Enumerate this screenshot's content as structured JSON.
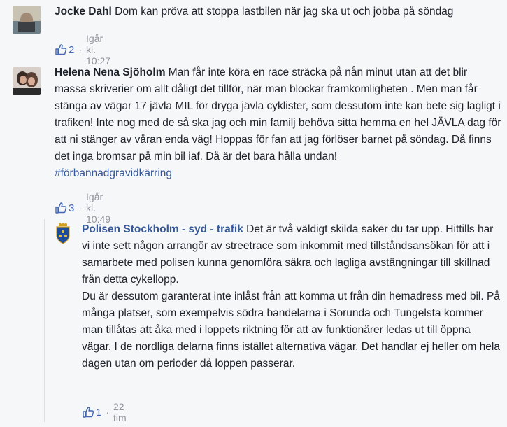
{
  "comments": [
    {
      "author": "Jocke Dahl",
      "text": "Dom kan pröva att stoppa lastbilen när jag ska ut och jobba på söndag",
      "likes": "2",
      "time": "Igår kl. 10:27"
    },
    {
      "author": "Helena Nena Sjöholm",
      "text": "Man får inte köra en race sträcka på nån minut utan att det blir massa skriverier om allt dåligt det tillför, när man blockar framkomligheten . Men man får stänga av vägar 17 jävla MIL för dryga jävla cyklister, som dessutom inte kan bete sig lagligt i trafiken! Inte nog med de så ska jag och min familj behöva sitta hemma en hel JÄVLA dag för att ni stänger av våran enda väg! Hoppas för fan att jag förlöser barnet på söndag. Då finns det inga bromsar på min bil iaf. Då är det bara hålla undan!",
      "hashtag": "#förbannadgravidkärring",
      "likes": "3",
      "time": "Igår kl. 10:49"
    },
    {
      "author": "Polisen Stockholm - syd - trafik",
      "text_p1": "Det är två väldigt skilda saker du tar upp. Hittills har vi inte sett någon arrangör av streetrace som inkommit med tillståndsansökan för att i samarbete med polisen kunna genomföra säkra och lagliga avstängningar till skillnad från detta cykellopp.",
      "text_p2": "Du är dessutom garanterat inte inlåst från att komma ut från din hemadress med bil. På många platser, som exempelvis södra bandelarna i Sorunda och Tungelsta kommer man tillåtas att åka med i loppets riktning för att av funktionärer ledas ut till öppna vägar. I de nordliga delarna finns istället alternativa vägar. Det handlar ej heller om hela dagen utan om perioder då loppen passerar.",
      "likes": "1",
      "time": "22 tim"
    }
  ],
  "colors": {
    "link": "#365899",
    "like": "#4267b2",
    "meta": "#90949c"
  }
}
